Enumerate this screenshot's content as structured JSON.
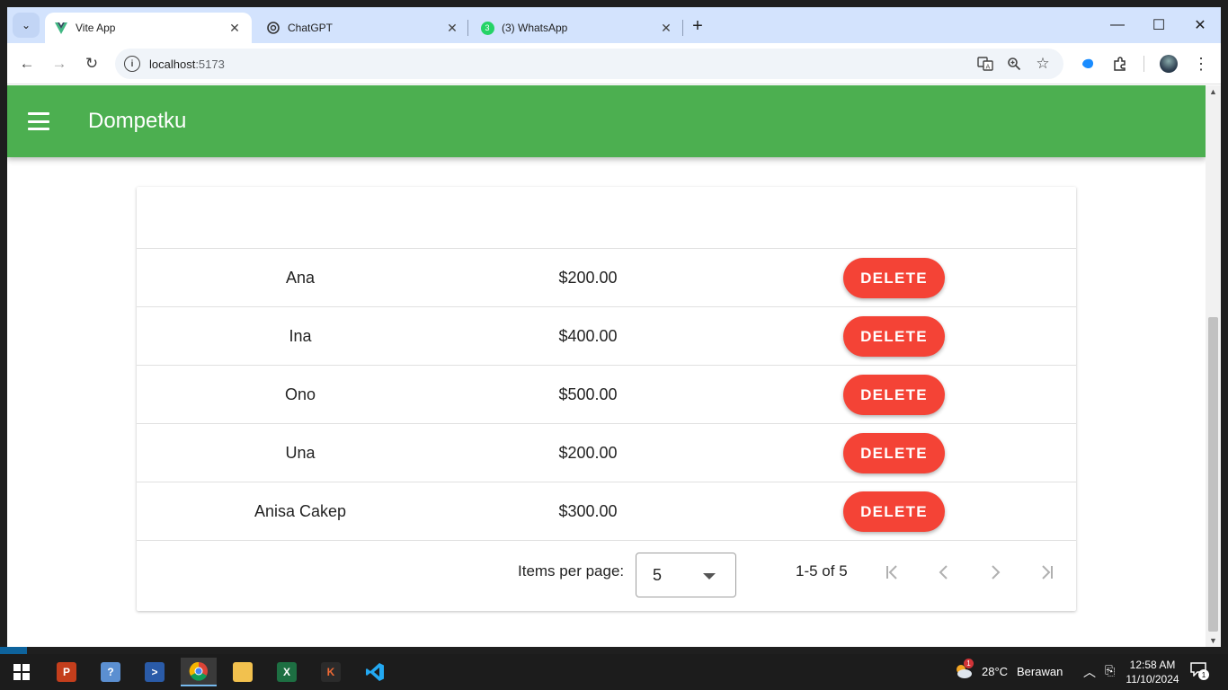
{
  "browser": {
    "tabs": [
      {
        "title": "Vite App",
        "icon": "vite-icon",
        "active": true
      },
      {
        "title": "ChatGPT",
        "icon": "chatgpt-icon",
        "active": false
      },
      {
        "title": "(3) WhatsApp",
        "icon": "whatsapp-icon",
        "badge": "3",
        "active": false
      }
    ],
    "url_host": "localhost",
    "url_port": ":5173"
  },
  "app": {
    "title": "Dompetku",
    "accent_color": "#4caf50",
    "delete_color": "#f44336"
  },
  "table": {
    "rows": [
      {
        "name": "Ana",
        "amount": "$200.00",
        "action": "DELETE"
      },
      {
        "name": "Ina",
        "amount": "$400.00",
        "action": "DELETE"
      },
      {
        "name": "Ono",
        "amount": "$500.00",
        "action": "DELETE"
      },
      {
        "name": "Una",
        "amount": "$200.00",
        "action": "DELETE"
      },
      {
        "name": "Anisa Cakep",
        "amount": "$300.00",
        "action": "DELETE"
      }
    ],
    "footer": {
      "items_per_page_label": "Items per page:",
      "items_per_page_value": "5",
      "range_text": "1-5 of 5"
    }
  },
  "taskbar": {
    "weather": {
      "temp": "28°C",
      "condition": "Berawan",
      "badge": "1"
    },
    "time": "12:58 AM",
    "date": "11/10/2024",
    "notification_count": "1"
  }
}
